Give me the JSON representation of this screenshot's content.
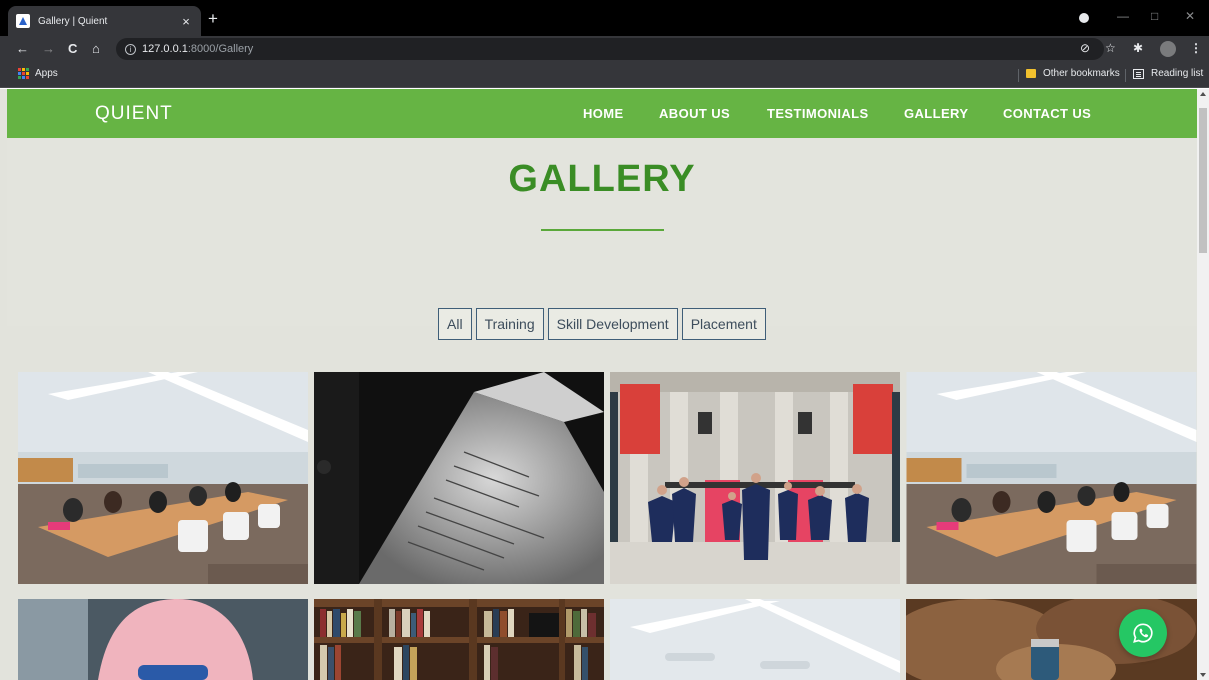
{
  "browser": {
    "tab_title": "Gallery | Quient",
    "tab_close": "×",
    "new_tab": "+",
    "url_host": "127.0.0.1",
    "url_path": ":8000/Gallery",
    "bookmarks": {
      "apps_label": "Apps",
      "other_bookmarks_label": "Other bookmarks",
      "reading_list_label": "Reading list"
    }
  },
  "site": {
    "brand": "QUIENT",
    "nav": [
      "HOME",
      "ABOUT US",
      "TESTIMONIALS",
      "GALLERY",
      "CONTACT US"
    ],
    "page_title": "GALLERY",
    "filters": [
      "All",
      "Training",
      "Skill Development",
      "Placement"
    ],
    "gallery_images": [
      "conference-room-meeting",
      "black-and-white-document",
      "graduation-ceremony",
      "conference-room-meeting",
      "person-in-pink-hoodie-with-controller",
      "bookshelf",
      "conference-room-ceiling",
      "warm-hands-with-can"
    ]
  },
  "colors": {
    "nav_green": "#66b444",
    "title_green": "#3a8d25",
    "whatsapp_green": "#25c764"
  }
}
